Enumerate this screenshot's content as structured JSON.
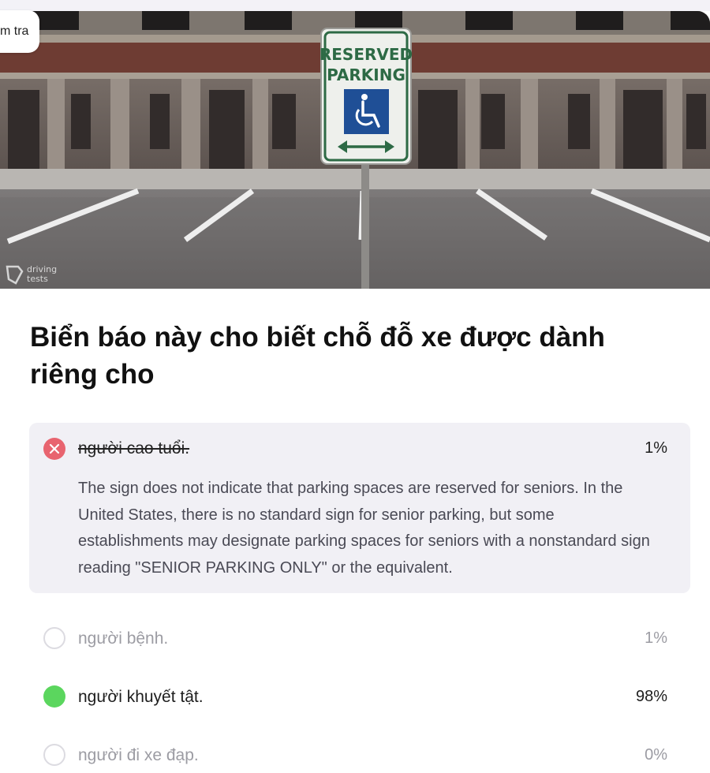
{
  "header": {
    "back_label": "m tra"
  },
  "image": {
    "sign_line1": "RESERVED",
    "sign_line2": "PARKING",
    "watermark_line1": "driving",
    "watermark_line2": "tests",
    "colors": {
      "sign_green": "#2d6a45",
      "sign_blue": "#1f4f96"
    }
  },
  "question": {
    "text": "Biển báo này cho biết chỗ đỗ xe được dành riêng cho"
  },
  "answers": [
    {
      "label": "người cao tuổi.",
      "percent": "1%",
      "state": "selected-wrong",
      "explanation": "The sign does not indicate that parking spaces are reserved for seniors. In the United States, there is no standard sign for senior parking, but some establishments may designate parking spaces for seniors with a nonstandard sign reading \"SENIOR PARKING ONLY\" or the equivalent."
    },
    {
      "label": "người bệnh.",
      "percent": "1%",
      "state": "unselected"
    },
    {
      "label": "người khuyết tật.",
      "percent": "98%",
      "state": "correct"
    },
    {
      "label": "người đi xe đạp.",
      "percent": "0%",
      "state": "unselected"
    }
  ],
  "colors": {
    "wrong": "#e8646f",
    "correct": "#5bd65e",
    "selected_bg": "#f1f0f5"
  }
}
